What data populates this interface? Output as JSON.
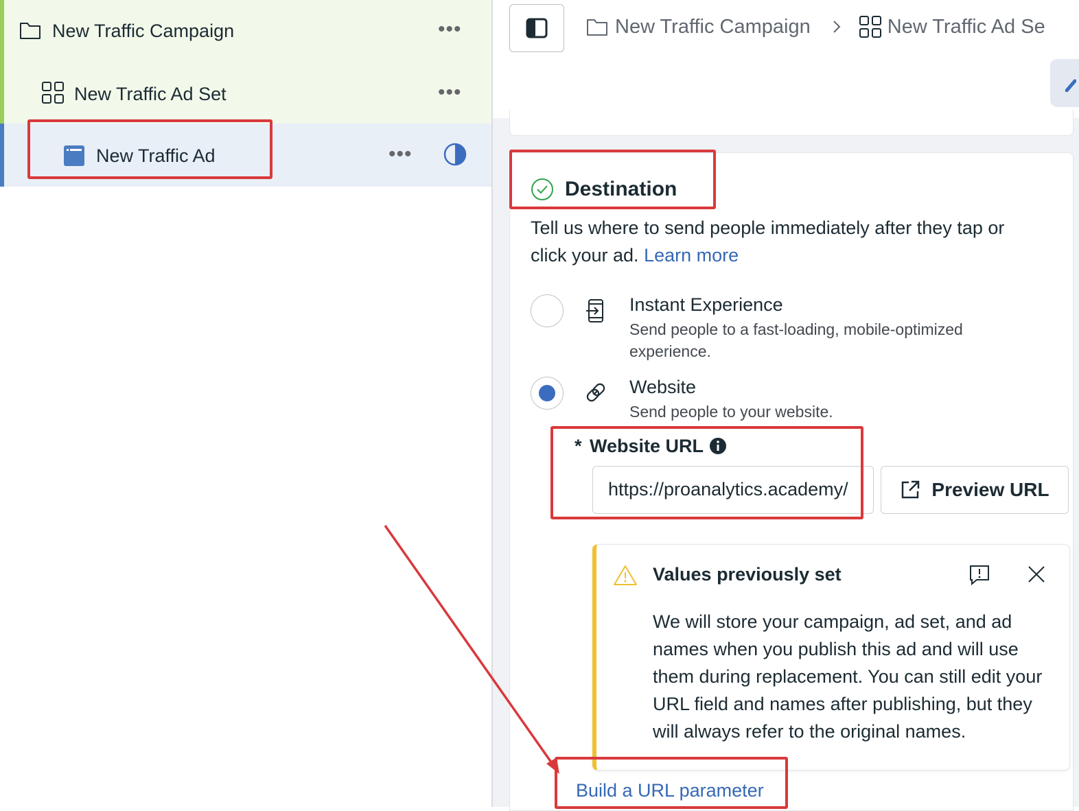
{
  "tree": {
    "campaign_label": "New Traffic Campaign",
    "adset_label": "New Traffic Ad Set",
    "ad_label": "New Traffic Ad",
    "more_glyph": "•••"
  },
  "breadcrumb": {
    "campaign": "New Traffic Campaign",
    "separator": ">",
    "adset": "New Traffic Ad Se"
  },
  "destination": {
    "title": "Destination",
    "description_line1": "Tell us where to send people immediately after they tap or",
    "description_line2": "click your ad.",
    "learn_more": "Learn more",
    "options": [
      {
        "title": "Instant Experience",
        "desc_line1": "Send people to a fast-loading, mobile-optimized",
        "desc_line2": "experience.",
        "selected": false
      },
      {
        "title": "Website",
        "desc_line1": "Send people to your website.",
        "selected": true
      }
    ],
    "url_required_mark": "*",
    "url_label": "Website URL",
    "url_value": "https://proanalytics.academy/",
    "preview_button": "Preview URL",
    "build_param_link": "Build a URL parameter"
  },
  "notice": {
    "title": "Values previously set",
    "body": "We will store your campaign, ad set, and ad names when you publish this ad and will use them during replacement. You can still edit your URL field and names after publishing, but they will always refer to the original names."
  },
  "colors": {
    "highlight": "#d9393c",
    "accent": "#3b6dbf",
    "warning": "#f0c030",
    "campaign_bar": "#9bcd5a",
    "ad_bar": "#4a7cc1"
  }
}
